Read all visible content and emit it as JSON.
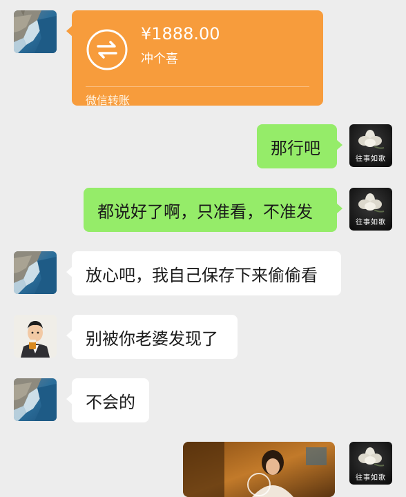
{
  "transfer": {
    "amount": "¥1888.00",
    "note": "冲个喜",
    "footer": "微信转账",
    "icon": "transfer-arrows-icon",
    "color": "#f79c3c"
  },
  "messages": [
    {
      "side": "right",
      "text": "那行吧"
    },
    {
      "side": "right",
      "text": "都说好了啊，只准看，不准发"
    },
    {
      "side": "left",
      "text": "放心吧，我自己保存下来偷偷看"
    },
    {
      "side": "left",
      "text": "别被你老婆发现了"
    },
    {
      "side": "left",
      "text": "不会的"
    }
  ],
  "avatar_right_label": "往事如歌",
  "colors": {
    "background": "#ededed",
    "bubble_self": "#95ec69",
    "bubble_other": "#ffffff"
  }
}
